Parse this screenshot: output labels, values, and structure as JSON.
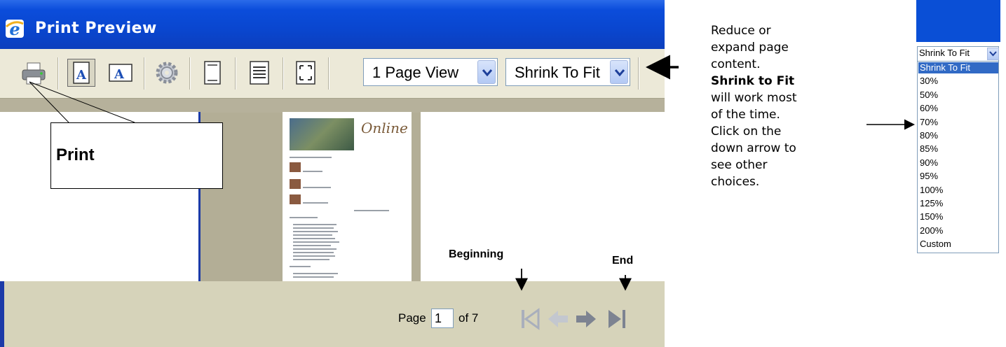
{
  "window": {
    "title": "Print Preview",
    "toolbar": {
      "page_view_value": "1 Page View",
      "shrink_value": "Shrink To Fit"
    },
    "status": {
      "page_label": "Page",
      "page_number": "1",
      "of_label": "of 7"
    }
  },
  "thumbnail": {
    "logo": "Online"
  },
  "callouts": {
    "print": "Print",
    "beginning": "Beginning",
    "end": "End",
    "note": {
      "part1": "Reduce or expand page content.",
      "bold": "Shrink to Fit",
      "part2": "will work most of the time. Click on the down arrow to see other choices."
    }
  },
  "dropdown": {
    "value": "Shrink To Fit",
    "options": [
      "Shrink To Fit",
      "30%",
      "50%",
      "60%",
      "70%",
      "80%",
      "85%",
      "90%",
      "95%",
      "100%",
      "125%",
      "150%",
      "200%",
      "Custom"
    ],
    "selected_index": 0
  },
  "colors": {
    "titlebar": "#0a46cf",
    "toolbar": "#ece9d8",
    "selection": "#316ac5"
  }
}
